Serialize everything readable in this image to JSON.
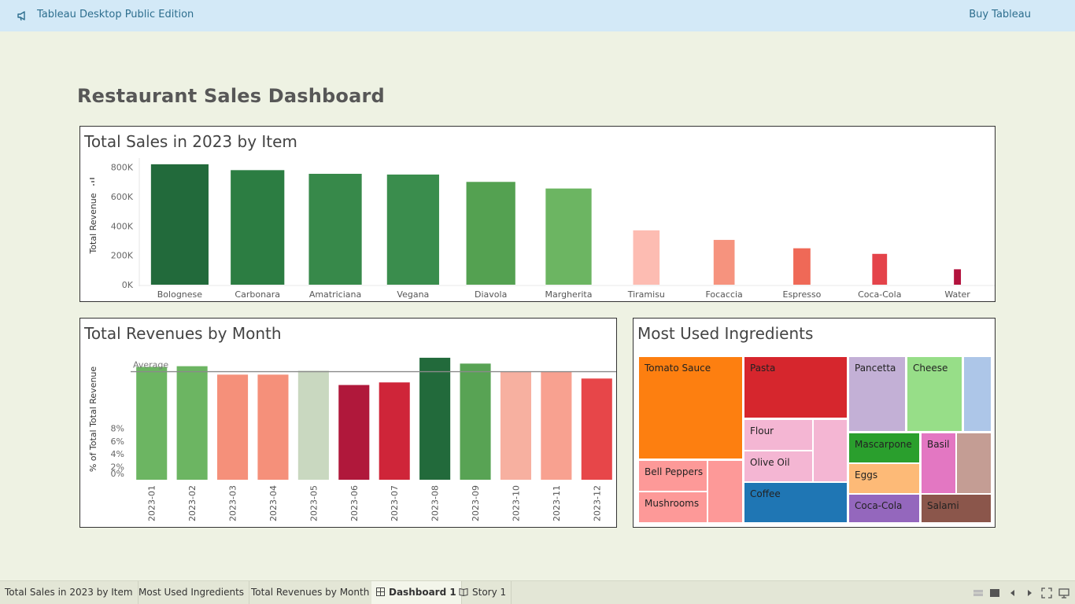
{
  "app": {
    "title": "Tableau Desktop Public Edition",
    "buy_label": "Buy Tableau"
  },
  "dashboard": {
    "title": "Restaurant Sales Dashboard"
  },
  "panels": {
    "sales": {
      "title": "Total Sales in 2023 by Item"
    },
    "months": {
      "title": "Total Revenues by Month"
    },
    "ingredients": {
      "title": "Most Used Ingredients"
    }
  },
  "chart_data": [
    {
      "type": "bar",
      "title": "Total Sales in 2023 by Item",
      "ylabel": "Total Revenue",
      "xlabel": "",
      "ylim": [
        0,
        830000
      ],
      "yticks": [
        {
          "v": 0,
          "label": "0K"
        },
        {
          "v": 200000,
          "label": "200K"
        },
        {
          "v": 400000,
          "label": "400K"
        },
        {
          "v": 600000,
          "label": "600K"
        },
        {
          "v": 800000,
          "label": "800K"
        }
      ],
      "categories": [
        "Bolognese",
        "Carbonara",
        "Amatriciana",
        "Vegana",
        "Diavola",
        "Margherita",
        "Tiramisu",
        "Focaccia",
        "Espresso",
        "Coca-Cola",
        "Water"
      ],
      "values": [
        820000,
        780000,
        755000,
        750000,
        700000,
        655000,
        370000,
        305000,
        248000,
        210000,
        105000
      ],
      "bar_widths": [
        0.74,
        0.69,
        0.68,
        0.67,
        0.63,
        0.59,
        0.34,
        0.27,
        0.22,
        0.19,
        0.09
      ],
      "colors": [
        "#226a3b",
        "#2c7d42",
        "#37894a",
        "#3a8d4d",
        "#54a151",
        "#6cb562",
        "#fdbcb2",
        "#f6937e",
        "#ef6957",
        "#e4434a",
        "#b3123d"
      ]
    },
    {
      "type": "bar",
      "title": "Total Revenues by Month",
      "ylabel": "% of Total Total Revenue",
      "xlabel": "",
      "ylim": [
        0,
        9.5
      ],
      "yticks": [
        {
          "v": 0,
          "label": "0%"
        },
        {
          "v": 2,
          "label": "2%"
        },
        {
          "v": 4,
          "label": "4%"
        },
        {
          "v": 6,
          "label": "6%"
        },
        {
          "v": 8,
          "label": "8%"
        }
      ],
      "reference_line": {
        "label": "Average",
        "value": 8.33
      },
      "categories": [
        "2023-01",
        "2023-02",
        "2023-03",
        "2023-04",
        "2023-05",
        "2023-06",
        "2023-07",
        "2023-08",
        "2023-09",
        "2023-10",
        "2023-11",
        "2023-12"
      ],
      "values": [
        8.7,
        8.75,
        8.1,
        8.1,
        8.4,
        7.3,
        7.5,
        9.4,
        8.95,
        8.35,
        8.35,
        7.8
      ],
      "colors": [
        "#6cb562",
        "#6cb562",
        "#f5907a",
        "#f5907a",
        "#c9d8c0",
        "#b0183b",
        "#cf2539",
        "#226a3b",
        "#58a354",
        "#f7b0a0",
        "#f8a190",
        "#e74649"
      ]
    },
    {
      "type": "treemap",
      "title": "Most Used Ingredients",
      "items": [
        {
          "name": "Tomato Sauce",
          "color": "#fd7f10"
        },
        {
          "name": "Pasta",
          "color": "#d6262d"
        },
        {
          "name": "Pancetta",
          "color": "#c3b0d6"
        },
        {
          "name": "Cheese",
          "color": "#97de88"
        },
        {
          "name": "",
          "color": "#adc6e8"
        },
        {
          "name": "Flour",
          "color": "#f4b6d3"
        },
        {
          "name": "Olive Oil",
          "color": "#f4b6d3"
        },
        {
          "name": "",
          "color": "#f4b6d3"
        },
        {
          "name": "Bell Peppers",
          "color": "#fd9998"
        },
        {
          "name": "Mushrooms",
          "color": "#fd9998"
        },
        {
          "name": "",
          "color": "#fd9998"
        },
        {
          "name": "Coffee",
          "color": "#1f76b4"
        },
        {
          "name": "Mascarpone",
          "color": "#2a9f2d"
        },
        {
          "name": "Basil",
          "color": "#e377c2"
        },
        {
          "name": "",
          "color": "#c49d94"
        },
        {
          "name": "Eggs",
          "color": "#fdba77"
        },
        {
          "name": "Coca-Cola",
          "color": "#9467bd"
        },
        {
          "name": "Salami",
          "color": "#8b564b"
        }
      ]
    }
  ],
  "tabs": [
    {
      "label": "Total Sales in 2023 by Item",
      "icon": ""
    },
    {
      "label": "Most Used Ingredients",
      "icon": ""
    },
    {
      "label": "Total Revenues by Month",
      "icon": ""
    },
    {
      "label": "Dashboard 1",
      "icon": "dashboard-grid-icon",
      "active": true
    },
    {
      "label": "Story 1",
      "icon": "story-book-icon"
    }
  ],
  "controls": [
    "show-sheet-sorter-icon",
    "show-filmstrip-icon",
    "prev-sheet-icon",
    "next-sheet-icon",
    "presentation-mode-icon",
    "device-preview-icon"
  ]
}
